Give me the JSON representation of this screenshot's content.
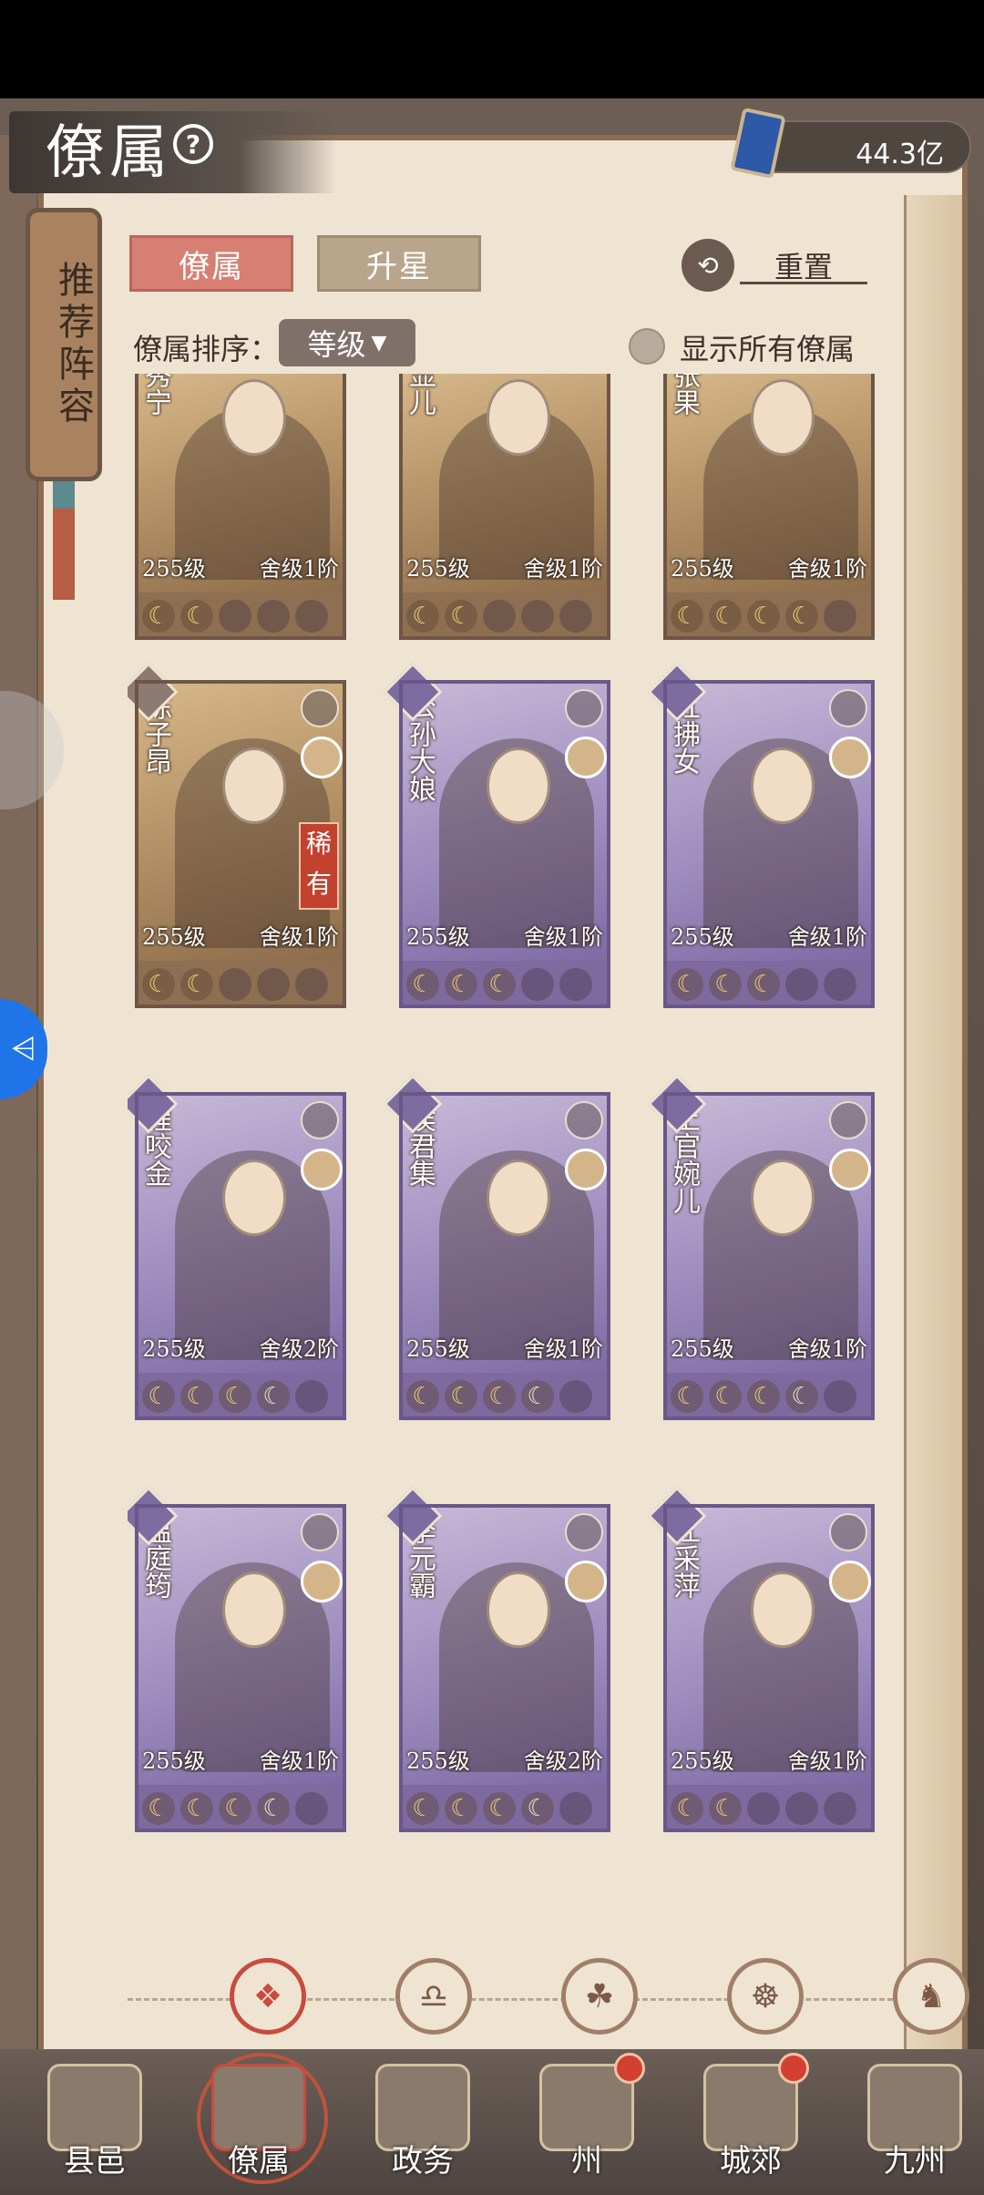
{
  "header": {
    "title": "僚属",
    "help_icon": "question-circle-icon",
    "currency_icon": "blue-book-icon",
    "currency_value": "44.3亿"
  },
  "recommend_tag": "推荐阵容",
  "tabs": [
    {
      "label": "僚属",
      "active": true
    },
    {
      "label": "升星",
      "active": false
    }
  ],
  "reset": {
    "label": "重置",
    "icon": "reset-icon"
  },
  "sort": {
    "label": "僚属排序：",
    "value": "等级"
  },
  "show_all": {
    "label": "显示所有僚属",
    "checked": false
  },
  "cards": [
    {
      "name": "秀宁",
      "level": "255级",
      "house": "舍级1阶",
      "stars": 2,
      "half": 0,
      "theme": "brown",
      "rare": ""
    },
    {
      "name": "显儿",
      "level": "255级",
      "house": "舍级1阶",
      "stars": 2,
      "half": 0,
      "theme": "brown",
      "rare": ""
    },
    {
      "name": "张果",
      "level": "255级",
      "house": "舍级1阶",
      "stars": 4,
      "half": 0,
      "theme": "brown",
      "rare": ""
    },
    {
      "name": "陈子昂",
      "level": "255级",
      "house": "舍级1阶",
      "stars": 2,
      "half": 0,
      "theme": "brown",
      "rare": "稀有"
    },
    {
      "name": "公孙大娘",
      "level": "255级",
      "house": "舍级1阶",
      "stars": 3,
      "half": 0,
      "theme": "purple",
      "rare": ""
    },
    {
      "name": "红拂女",
      "level": "255级",
      "house": "舍级1阶",
      "stars": 3,
      "half": 0,
      "theme": "purple",
      "rare": ""
    },
    {
      "name": "程咬金",
      "level": "255级",
      "house": "舍级2阶",
      "stars": 3,
      "half": 1,
      "theme": "purple",
      "rare": ""
    },
    {
      "name": "侯君集",
      "level": "255级",
      "house": "舍级1阶",
      "stars": 3,
      "half": 1,
      "theme": "purple",
      "rare": ""
    },
    {
      "name": "上官婉儿",
      "level": "255级",
      "house": "舍级1阶",
      "stars": 3,
      "half": 1,
      "theme": "purple",
      "rare": ""
    },
    {
      "name": "温庭筠",
      "level": "255级",
      "house": "舍级1阶",
      "stars": 3,
      "half": 1,
      "theme": "purple",
      "rare": ""
    },
    {
      "name": "李元霸",
      "level": "255级",
      "house": "舍级2阶",
      "stars": 3,
      "half": 1,
      "theme": "purple",
      "rare": ""
    },
    {
      "name": "江采萍",
      "level": "255级",
      "house": "舍级1阶",
      "stars": 2,
      "half": 0,
      "theme": "purple",
      "rare": ""
    }
  ],
  "filters": [
    {
      "name": "all-filter",
      "glyph": "❖",
      "active": true
    },
    {
      "name": "bell-filter",
      "glyph": "♎",
      "active": false
    },
    {
      "name": "cat-filter",
      "glyph": "☘",
      "active": false
    },
    {
      "name": "fan-filter",
      "glyph": "☸",
      "active": false
    },
    {
      "name": "beast-filter",
      "glyph": "♞",
      "active": false
    }
  ],
  "nav": [
    {
      "label": "县邑",
      "badge": false,
      "active": false
    },
    {
      "label": "僚属",
      "badge": false,
      "active": true
    },
    {
      "label": "政务",
      "badge": false,
      "active": false
    },
    {
      "label": "州",
      "badge": true,
      "active": false
    },
    {
      "label": "城郊",
      "badge": true,
      "active": false
    },
    {
      "label": "九州",
      "badge": false,
      "active": false
    }
  ]
}
